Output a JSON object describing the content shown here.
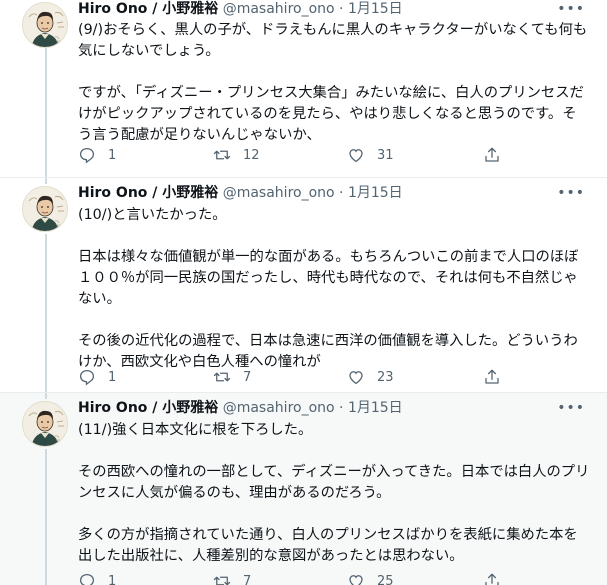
{
  "tweets": [
    {
      "name": "Hiro Ono / 小野雅裕",
      "handle": "@masahiro_ono",
      "dot": "·",
      "date": "1月15日",
      "more": "•••",
      "text": "(9/)おそらく、黒人の子が、ドラえもんに黒人のキャラクターがいなくても何も気にしないでしょう。\n\nですが、「ディズニー・プリンセス大集合」みたいな絵に、白人のプリンセスだけがピックアップされているのを見たら、やはり悲しくなると思うのです。そう言う配慮が足りないんじゃないか、",
      "replies": "1",
      "retweets": "12",
      "likes": "31"
    },
    {
      "name": "Hiro Ono / 小野雅裕",
      "handle": "@masahiro_ono",
      "dot": "·",
      "date": "1月15日",
      "more": "•••",
      "text": "(10/)と言いたかった。\n\n日本は様々な価値観が単一的な面がある。もちろんついこの前まで人口のほぼ１００％が同一民族の国だったし、時代も時代なので、それは何も不自然じゃない。\n\nその後の近代化の過程で、日本は急速に西洋の価値観を導入した。どういうわけか、西欧文化や白色人種への憧れが",
      "replies": "1",
      "retweets": "7",
      "likes": "23"
    },
    {
      "name": "Hiro Ono / 小野雅裕",
      "handle": "@masahiro_ono",
      "dot": "·",
      "date": "1月15日",
      "more": "•••",
      "text": "(11/)強く日本文化に根を下ろした。\n\nその西欧への憧れの一部として、ディズニーが入ってきた。日本では白人のプリンセスに人気が偏るのも、理由があるのだろう。\n\n多くの方が指摘されていた通り、白人のプリンセスばかりを表紙に集めた本を出した出版社に、人種差別的な意図があったとは思わない。",
      "replies": "1",
      "retweets": "7",
      "likes": "25"
    }
  ],
  "icons": {
    "reply": "reply-icon",
    "retweet": "retweet-icon",
    "like": "heart-icon",
    "share": "share-icon",
    "more": "more-icon",
    "avatar": "avatar-image"
  },
  "colors": {
    "text": "#0f1419",
    "secondary": "#536471",
    "divider": "#e6ecf0",
    "thread_line": "#cfd9de",
    "highlight_bg": "#f7f9f9"
  }
}
